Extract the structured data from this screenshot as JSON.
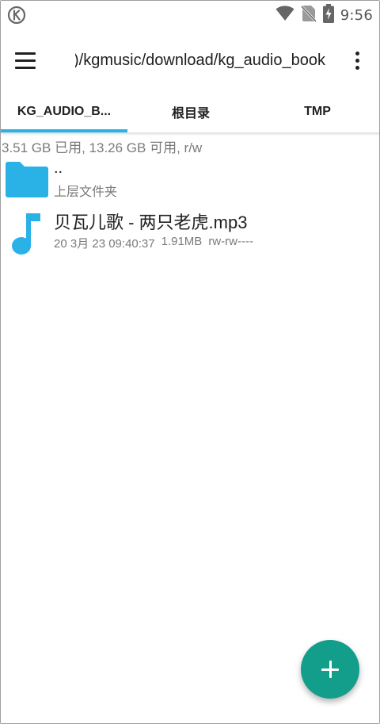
{
  "status_bar": {
    "time": "9:56",
    "icons": [
      "k-app-icon",
      "wifi-icon",
      "no-sim-icon",
      "battery-charging-icon"
    ]
  },
  "toolbar": {
    "path": ")/kgmusic/download/kg_audio_book",
    "menu_icon": "hamburger-menu-icon",
    "more_icon": "more-vert-icon"
  },
  "tabs": [
    {
      "label": "KG_AUDIO_B...",
      "active": true
    },
    {
      "label": "根目录",
      "active": false
    },
    {
      "label": "TMP",
      "active": false
    }
  ],
  "storage_info": "3.51 GB 已用, 13.26 GB 可用, r/w",
  "items": {
    "parent": {
      "title": "..",
      "subtitle": "上层文件夹",
      "icon": "folder-icon"
    },
    "file": {
      "title": "贝瓦儿歌 - 两只老虎.mp3",
      "date": "20 3月 23 09:40:37",
      "size": "1.91MB",
      "permissions": "rw-rw----",
      "icon": "music-note-icon"
    }
  },
  "fab": {
    "icon": "plus-icon"
  },
  "colors": {
    "accent": "#2ab2e6",
    "fab": "#139e8b",
    "folder": "#2ab2e6"
  }
}
